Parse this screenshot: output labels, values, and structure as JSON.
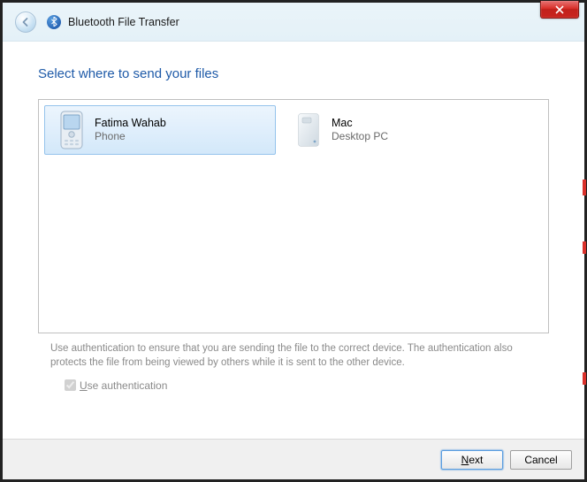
{
  "window": {
    "title": "Bluetooth File Transfer"
  },
  "heading": "Select where to send your files",
  "devices": [
    {
      "name": "Fatima Wahab",
      "type": "Phone",
      "selected": true
    },
    {
      "name": "Mac",
      "type": "Desktop PC",
      "selected": false
    }
  ],
  "hint": "Use authentication to ensure that you are sending the file to the correct device. The authentication also protects the file from being viewed by others while it is sent to the other device.",
  "auth": {
    "label_pre": "U",
    "label_rest": "se authentication",
    "checked": true
  },
  "buttons": {
    "next_pre": "N",
    "next_rest": "ext",
    "cancel": "Cancel"
  }
}
